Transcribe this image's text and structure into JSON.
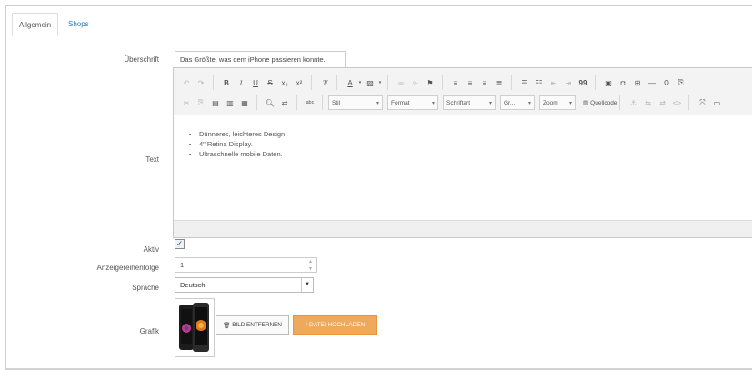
{
  "tabs": [
    {
      "label": "Allgemein",
      "active": true
    },
    {
      "label": "Shops",
      "active": false
    }
  ],
  "fields": {
    "headline": {
      "label": "Überschrift",
      "value": "Das Größte, was dem iPhone passieren konnte."
    },
    "text": {
      "label": "Text",
      "bullets": [
        "Dünneres, leichteres Design",
        "4\" Retina Display.",
        "Ultraschnelle mobile Daten."
      ]
    },
    "active": {
      "label": "Aktiv",
      "checked": true,
      "mark": "✓"
    },
    "order": {
      "label": "Anzeigereihenfolge",
      "value": "1"
    },
    "language": {
      "label": "Sprache",
      "value": "Deutsch"
    },
    "image": {
      "label": "Grafik",
      "remove_label": "BILD ENTFERNEN",
      "upload_label": "DATEI HOCHLADEN"
    }
  },
  "editor": {
    "combos": [
      {
        "label": "Stil"
      },
      {
        "label": "Format"
      },
      {
        "label": "Schriftart"
      },
      {
        "label": "Gr..."
      },
      {
        "label": "Zoom"
      }
    ],
    "source_label": "Quellcode",
    "format_buttons": {
      "bold": "B",
      "italic": "I",
      "underline": "U",
      "strike": "S",
      "sub": "x₂",
      "sup": "x²",
      "quote": "99",
      "omega": "Ω"
    }
  },
  "colors": {
    "link": "#2b7bb9",
    "upload_button": "#f0a95a",
    "border": "#cccccc"
  }
}
